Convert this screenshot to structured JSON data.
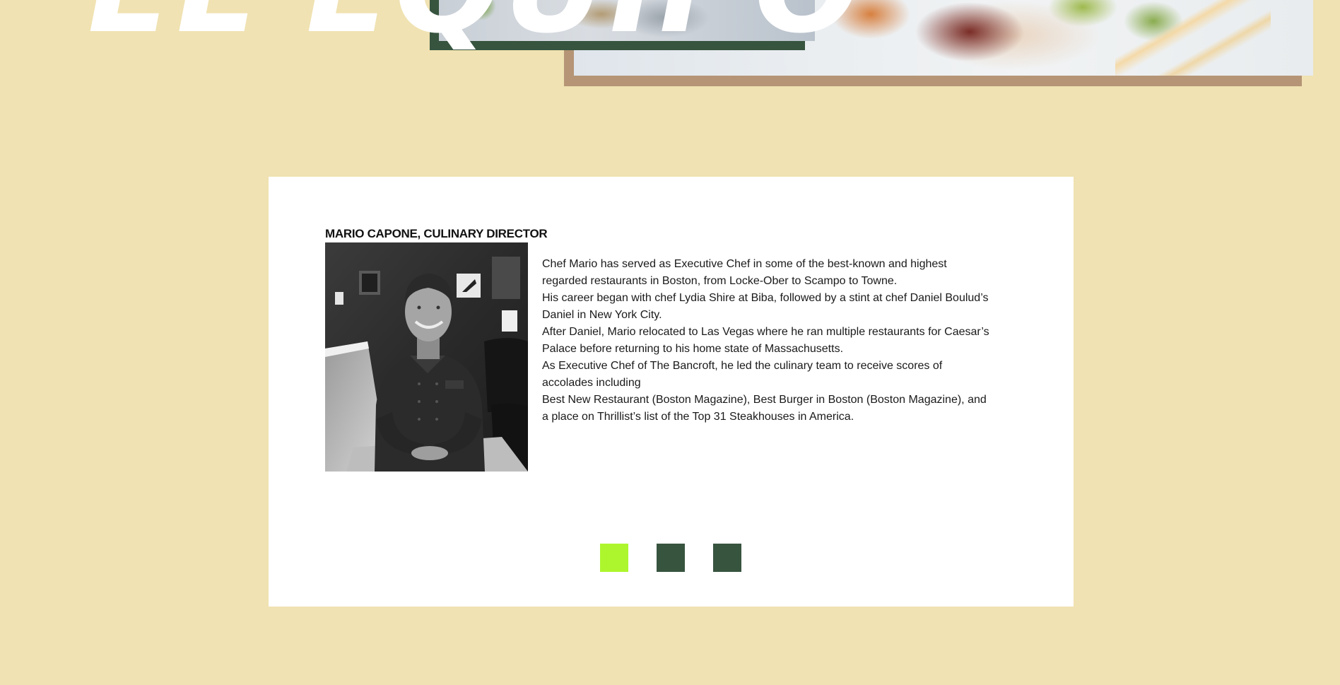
{
  "hero": {
    "title": "EL EQUIPO"
  },
  "team": {
    "member": {
      "name": "MARIO CAPONE, CULINARY DIRECTOR",
      "photo_alt": "Portrait of Mario Capone",
      "bio": [
        "Chef Mario has served as Executive Chef in some of the best-known and highest regarded restaurants in Boston, from Locke-Ober to Scampo to Towne.",
        "His career began with chef Lydia Shire at Biba, followed by a stint at chef Daniel Boulud’s Daniel in New York City.",
        "After Daniel, Mario relocated to Las Vegas where he ran multiple restaurants for Caesar’s Palace before returning to his home state of Massachusetts.",
        "As Executive Chef of The Bancroft, he led the culinary team to receive scores of accolades including",
        "Best New Restaurant (Boston Magazine), Best Burger in Boston (Boston Magazine), and a place on Thrillist’s list of the Top 31 Steakhouses in America."
      ]
    },
    "carousel": {
      "slide_count": 3,
      "active_index": 0
    }
  },
  "colors": {
    "page_background": "#f0e2b2",
    "card_background": "#ffffff",
    "accent_green_dark": "#37543f",
    "accent_lime": "#adf62e",
    "accent_tan": "#b59576"
  }
}
